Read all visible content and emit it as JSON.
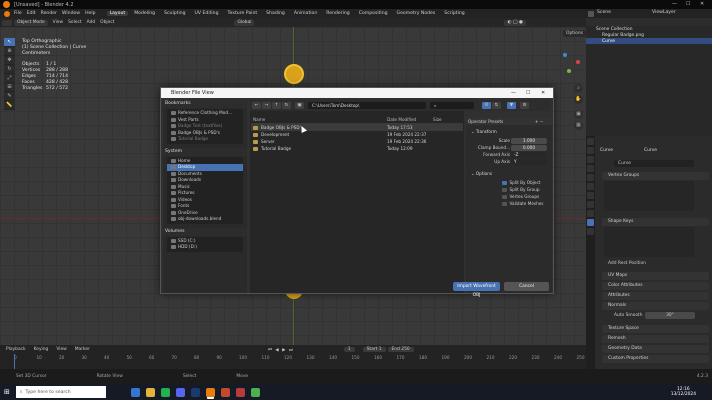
{
  "window": {
    "title": "[Unsaved] - Blender 4.2",
    "minimize": "—",
    "maximize": "☐",
    "close": "✕"
  },
  "menu": [
    "File",
    "Edit",
    "Render",
    "Window",
    "Help"
  ],
  "workspaces": [
    "Layout",
    "Modeling",
    "Sculpting",
    "UV Editing",
    "Texture Paint",
    "Shading",
    "Animation",
    "Rendering",
    "Compositing",
    "Geometry Nodes",
    "Scripting"
  ],
  "active_workspace": "Layout",
  "scene": {
    "label": "Scene",
    "viewlayer": "ViewLayer"
  },
  "viewport_header": {
    "mode": "Object Mode",
    "view": "View",
    "select": "Select",
    "add": "Add",
    "object": "Object",
    "orientation": "Global",
    "options": "Options"
  },
  "viewport_info": {
    "view": "Top Orthographic",
    "collection": "(1) Scene Collection | Curve",
    "units": "Centimeters",
    "objects_label": "Objects",
    "objects": "1 / 1",
    "vertices_label": "Vertices",
    "vertices": "288 / 288",
    "edges_label": "Edges",
    "edges": "714 / 714",
    "faces_label": "Faces",
    "faces": "428 / 428",
    "triangles_label": "Triangles",
    "triangles": "572 / 572"
  },
  "outliner": {
    "root": "Scene Collection",
    "items": [
      "Regular Badge.png",
      "Curve"
    ]
  },
  "properties": {
    "object": "Curve",
    "data": "Curve",
    "datablock": "Curve",
    "sections": [
      "Vertex Groups",
      "Shape Keys",
      "UV Maps",
      "Color Attributes",
      "Attributes",
      "Normals",
      "Texture Space",
      "Remesh",
      "Geometry Data",
      "Custom Properties"
    ],
    "add_rest": "Add Rest Position",
    "auto_smooth": "Auto Smooth",
    "auto_smooth_val": "30°"
  },
  "timeline": {
    "menus": [
      "Playback",
      "Keying",
      "View",
      "Marker"
    ],
    "start_label": "Start",
    "start": "1",
    "end_label": "End",
    "end": "250",
    "frame": "1",
    "ticks": [
      "0",
      "10",
      "20",
      "30",
      "40",
      "50",
      "60",
      "70",
      "80",
      "90",
      "100",
      "110",
      "120",
      "130",
      "140",
      "150",
      "160",
      "170",
      "180",
      "190",
      "200",
      "210",
      "220",
      "230",
      "240",
      "250"
    ]
  },
  "status": {
    "set_cursor": "Set 3D Cursor",
    "rotate": "Rotate View",
    "select": "Select",
    "move": "Move",
    "version": "4.2.3"
  },
  "taskbar": {
    "search": "Type here to search",
    "time": "12:16",
    "date": "13/12/2024"
  },
  "dialog": {
    "title": "Blender File View",
    "bookmarks_label": "Bookmarks",
    "bookmarks": [
      {
        "label": "Reference Clothing Mod...",
        "dim": false
      },
      {
        "label": "Vest Parts",
        "dim": false
      },
      {
        "label": "Badge Test (textfiles)",
        "dim": true
      },
      {
        "label": "Badge OBJs & PSD's",
        "dim": false
      },
      {
        "label": "Tutorial Badge",
        "dim": true
      }
    ],
    "system_label": "System",
    "system": [
      {
        "label": "Home",
        "sel": false
      },
      {
        "label": "Desktop",
        "sel": true
      },
      {
        "label": "Documents",
        "sel": false
      },
      {
        "label": "Downloads",
        "sel": false
      },
      {
        "label": "Music",
        "sel": false
      },
      {
        "label": "Pictures",
        "sel": false
      },
      {
        "label": "Videos",
        "sel": false
      },
      {
        "label": "Fonts",
        "sel": false
      },
      {
        "label": "OneDrive",
        "sel": false
      },
      {
        "label": "obj-downloads.blend",
        "sel": false
      }
    ],
    "volumes_label": "Volumes",
    "volumes": [
      "SSD (C:)",
      "HDD (D:)"
    ],
    "path": "C:\\Users\\Tom\\Desktop\\",
    "columns": {
      "name": "Name",
      "date": "Date Modified",
      "size": "Size"
    },
    "files": [
      {
        "name": "Badge OBJs & PSD's",
        "date": "Today 17:53"
      },
      {
        "name": "Development",
        "date": "19 Feb 2024 22:37"
      },
      {
        "name": "Server",
        "date": "19 Feb 2024 22:36"
      },
      {
        "name": "Tutorial Badge",
        "date": "Today 12:09"
      }
    ],
    "operator_presets": "Operator Presets",
    "transform_label": "Transform",
    "scale_label": "Scale",
    "scale": "1.000",
    "clamp_label": "Clamp Bound...",
    "clamp": "0.000",
    "forward_label": "Forward Axis",
    "forward": "-Z",
    "up_label": "Up Axis",
    "up": "Y",
    "options_label": "Options",
    "options": [
      {
        "label": "Split By Object",
        "on": true
      },
      {
        "label": "Split By Group",
        "on": false
      },
      {
        "label": "Vertex Groups",
        "on": false
      },
      {
        "label": "Validate Meshes",
        "on": false
      }
    ],
    "import_button": "Import Wavefront OBJ",
    "cancel_button": "Cancel"
  },
  "colors": {
    "accent": "#4772b3",
    "header": "#232323",
    "viewport": "#393939",
    "object_orange": "#d9a21a"
  }
}
